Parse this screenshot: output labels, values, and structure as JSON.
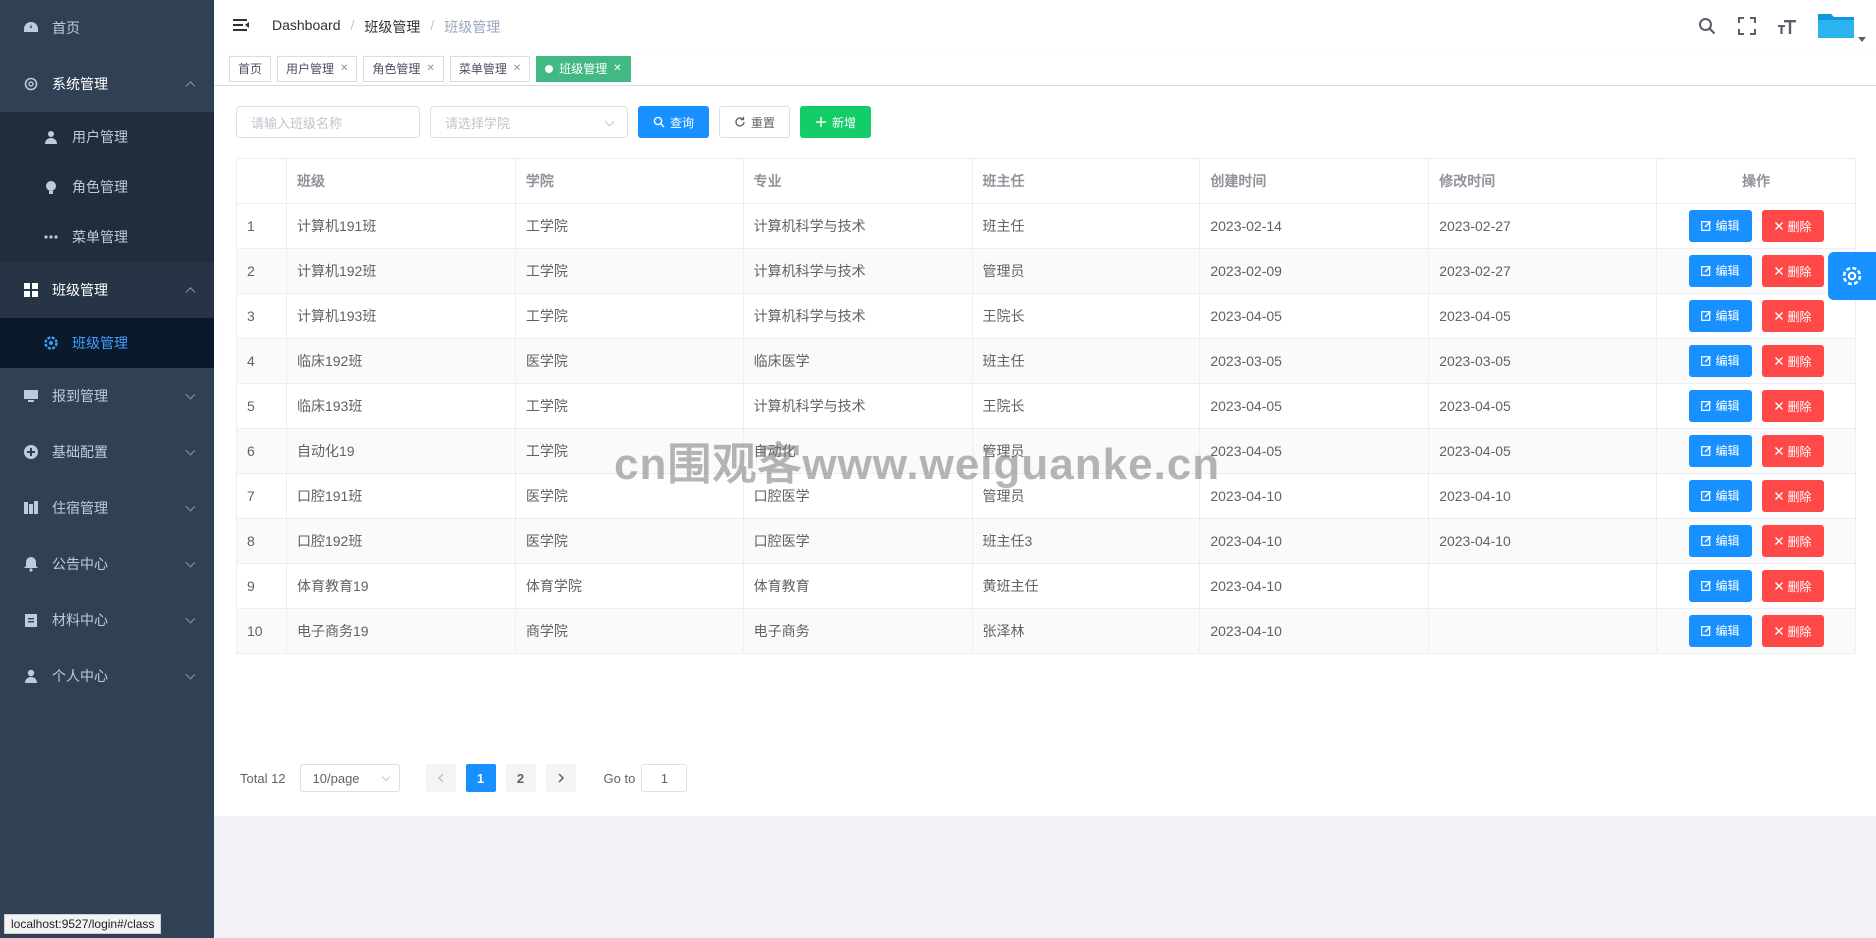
{
  "sidebar": {
    "items": [
      {
        "label": "首页",
        "icon": "dashboard-icon"
      },
      {
        "label": "系统管理",
        "icon": "gear-icon",
        "children": [
          {
            "label": "用户管理",
            "icon": "user-icon"
          },
          {
            "label": "角色管理",
            "icon": "bulb-icon"
          },
          {
            "label": "菜单管理",
            "icon": "more-icon"
          }
        ]
      },
      {
        "label": "班级管理",
        "icon": "grid-icon",
        "children": [
          {
            "label": "班级管理",
            "icon": "gear-icon"
          }
        ]
      },
      {
        "label": "报到管理",
        "icon": "monitor-icon"
      },
      {
        "label": "基础配置",
        "icon": "circle-plus-icon"
      },
      {
        "label": "住宿管理",
        "icon": "building-icon"
      },
      {
        "label": "公告中心",
        "icon": "bell-icon"
      },
      {
        "label": "材料中心",
        "icon": "clipboard-icon"
      },
      {
        "label": "个人中心",
        "icon": "person-icon"
      }
    ]
  },
  "breadcrumb": [
    "Dashboard",
    "班级管理",
    "班级管理"
  ],
  "tags": [
    {
      "label": "首页",
      "closable": false
    },
    {
      "label": "用户管理",
      "closable": true
    },
    {
      "label": "角色管理",
      "closable": true
    },
    {
      "label": "菜单管理",
      "closable": true
    },
    {
      "label": "班级管理",
      "closable": true,
      "active": true
    }
  ],
  "filter": {
    "class_placeholder": "请输入班级名称",
    "college_placeholder": "请选择学院",
    "search_label": "查询",
    "reset_label": "重置",
    "add_label": "新增"
  },
  "table": {
    "headers": [
      "",
      "班级",
      "学院",
      "专业",
      "班主任",
      "创建时间",
      "修改时间",
      "操作"
    ],
    "rows": [
      [
        "1",
        "计算机191班",
        "工学院",
        "计算机科学与技术",
        "班主任",
        "2023-02-14",
        "2023-02-27"
      ],
      [
        "2",
        "计算机192班",
        "工学院",
        "计算机科学与技术",
        "管理员",
        "2023-02-09",
        "2023-02-27"
      ],
      [
        "3",
        "计算机193班",
        "工学院",
        "计算机科学与技术",
        "王院长",
        "2023-04-05",
        "2023-04-05"
      ],
      [
        "4",
        "临床192班",
        "医学院",
        "临床医学",
        "班主任",
        "2023-03-05",
        "2023-03-05"
      ],
      [
        "5",
        "临床193班",
        "工学院",
        "计算机科学与技术",
        "王院长",
        "2023-04-05",
        "2023-04-05"
      ],
      [
        "6",
        "自动化19",
        "工学院",
        "自动化",
        "管理员",
        "2023-04-05",
        "2023-04-05"
      ],
      [
        "7",
        "口腔191班",
        "医学院",
        "口腔医学",
        "管理员",
        "2023-04-10",
        "2023-04-10"
      ],
      [
        "8",
        "口腔192班",
        "医学院",
        "口腔医学",
        "班主任3",
        "2023-04-10",
        "2023-04-10"
      ],
      [
        "9",
        "体育教育19",
        "体育学院",
        "体育教育",
        "黄班主任",
        "2023-04-10",
        ""
      ],
      [
        "10",
        "电子商务19",
        "商学院",
        "电子商务",
        "张泽林",
        "2023-04-10",
        ""
      ]
    ],
    "edit_label": "编辑",
    "delete_label": "删除"
  },
  "pagination": {
    "total_label": "Total 12",
    "page_size": "10/page",
    "pages": [
      "1",
      "2"
    ],
    "current": "1",
    "goto_label": "Go to",
    "goto_value": "1"
  },
  "watermark": "cn围观客www.weiguanke.cn",
  "statusbar": "localhost:9527/login#/class",
  "colors": {
    "sidebar_bg": "#304156",
    "primary": "#1890ff",
    "success": "#13ce66",
    "danger": "#ff4949",
    "tag_active": "#42b983"
  }
}
